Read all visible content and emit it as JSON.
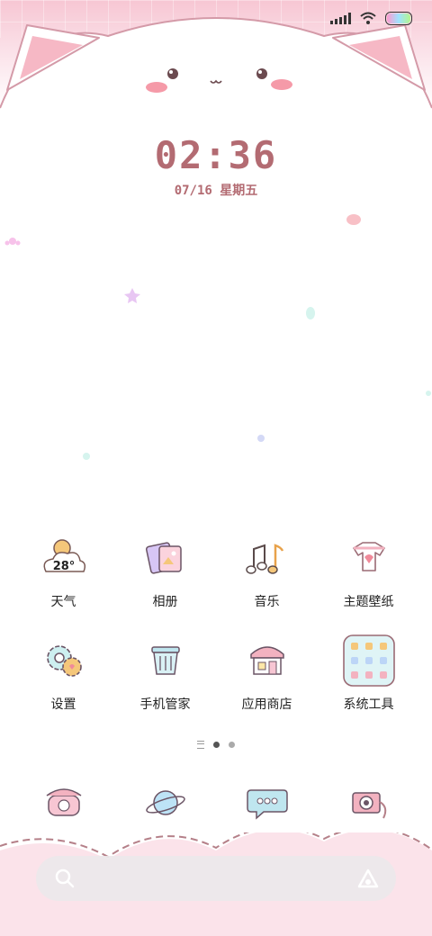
{
  "lockscreen": {
    "time": "02:36",
    "date": "07/16 星期五"
  },
  "apps": [
    {
      "label": "天气",
      "icon": "weather-cloud-icon",
      "badge": "28°"
    },
    {
      "label": "相册",
      "icon": "photo-album-icon"
    },
    {
      "label": "音乐",
      "icon": "music-notes-icon"
    },
    {
      "label": "主题壁纸",
      "icon": "theme-shirt-icon"
    },
    {
      "label": "设置",
      "icon": "settings-gear-icon"
    },
    {
      "label": "手机管家",
      "icon": "trash-bin-icon"
    },
    {
      "label": "应用商店",
      "icon": "shop-icon"
    },
    {
      "label": "系统工具",
      "icon": "tools-folder-icon"
    }
  ],
  "dock": [
    {
      "icon": "phone-icon"
    },
    {
      "icon": "browser-planet-icon"
    },
    {
      "icon": "message-bubble-icon"
    },
    {
      "icon": "camera-icon"
    }
  ],
  "page_indicator": {
    "pages": 3,
    "current": 2
  },
  "colors": {
    "accent": "#b36b72",
    "pink": "#f7c6d3",
    "outline": "#d9a3b0"
  }
}
